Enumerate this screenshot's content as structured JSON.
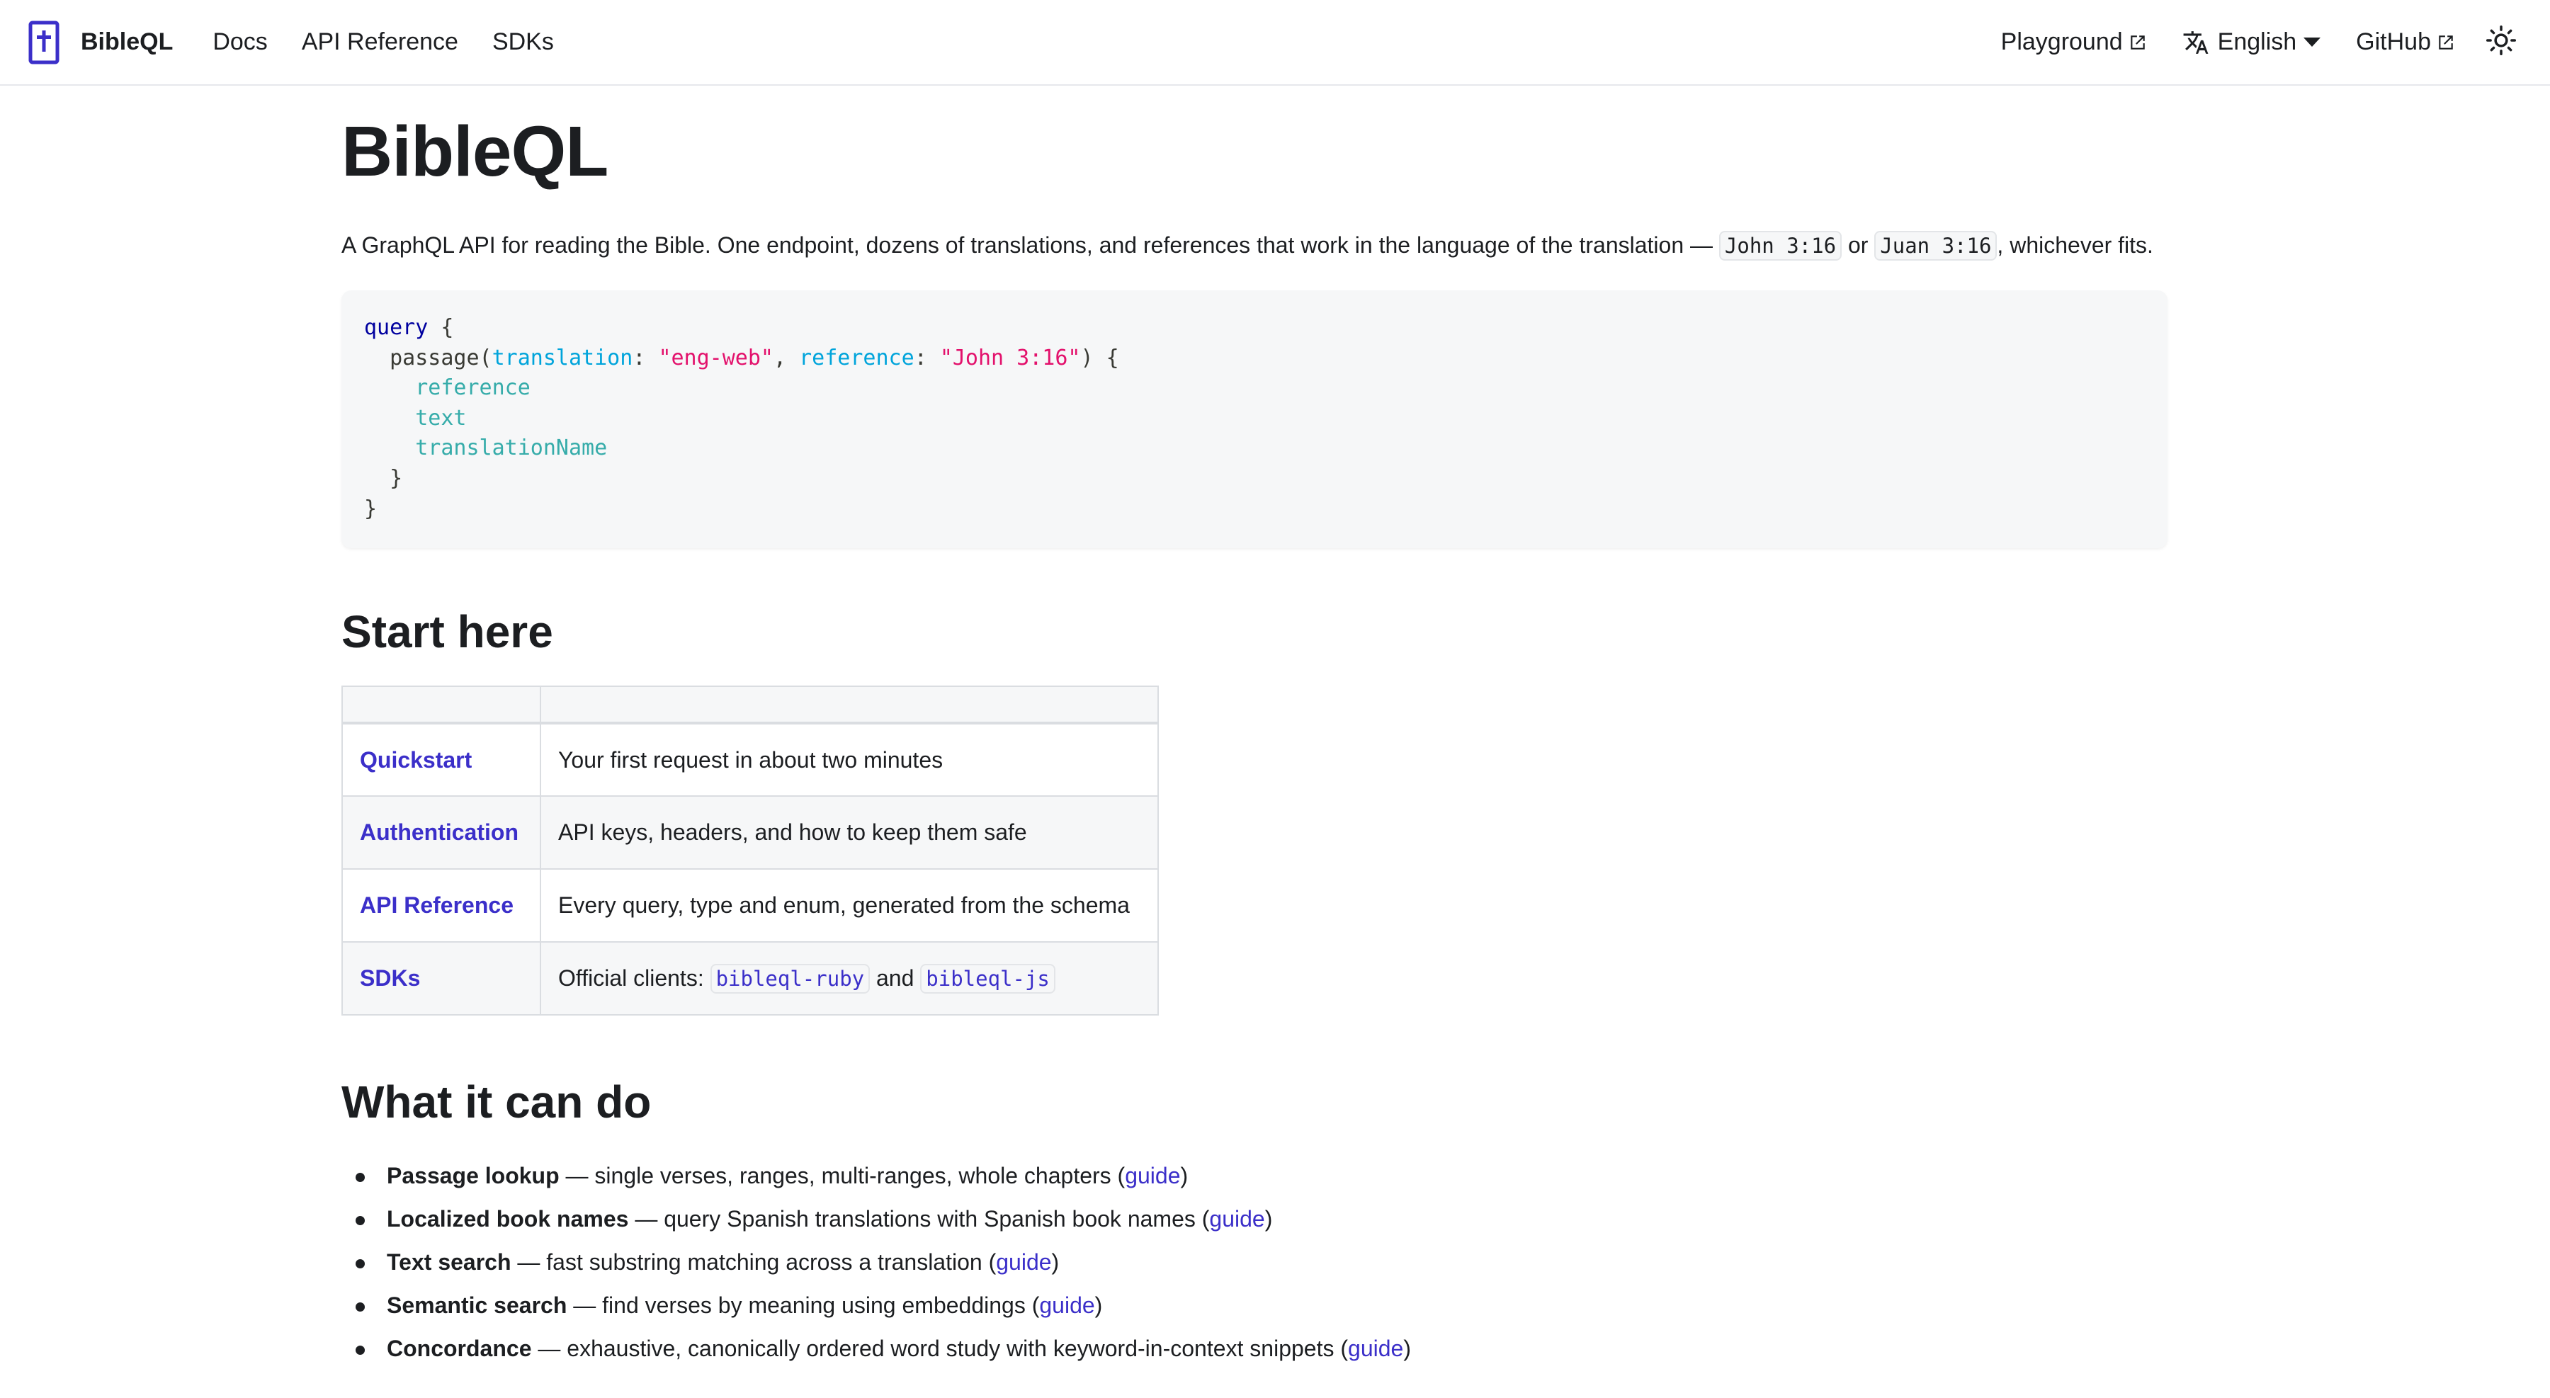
{
  "nav": {
    "brand": "BibleQL",
    "links": [
      "Docs",
      "API Reference",
      "SDKs"
    ],
    "playground": "Playground",
    "language": "English",
    "github": "GitHub"
  },
  "page": {
    "title": "BibleQL",
    "intro_text": "A GraphQL API for reading the Bible. One endpoint, dozens of translations, and references that work in the language of the translation —",
    "intro_code1": "John 3:16",
    "intro_or": "or",
    "intro_code2": "Juan 3:16",
    "intro_end": ", whichever fits."
  },
  "code_example": {
    "l1_kw": "query",
    "l1_rest": " {",
    "l2_indent": "  passage(",
    "l2_arg1": "translation",
    "l2_sep1": ": ",
    "l2_val1": "\"eng-web\"",
    "l2_comma": ", ",
    "l2_arg2": "reference",
    "l2_sep2": ": ",
    "l2_val2": "\"John 3:16\"",
    "l2_end": ") {",
    "fields": [
      "reference",
      "text",
      "translationName"
    ],
    "l6": "  }",
    "l7": "}"
  },
  "start_here": {
    "heading": "Start here",
    "rows": [
      {
        "link": "Quickstart",
        "desc": "Your first request in about two minutes"
      },
      {
        "link": "Authentication",
        "desc": "API keys, headers, and how to keep them safe"
      },
      {
        "link": "API Reference",
        "desc": "Every query, type and enum, generated from the schema"
      },
      {
        "link": "SDKs",
        "desc_prefix": "Official clients:",
        "pkg1": "bibleql-ruby",
        "and": "and",
        "pkg2": "bibleql-js"
      }
    ]
  },
  "features": {
    "heading": "What it can do",
    "items": [
      {
        "title": "Passage lookup",
        "desc": " — single verses, ranges, multi-ranges, whole chapters (",
        "link": "guide",
        "close": ")"
      },
      {
        "title": "Localized book names",
        "desc": " — query Spanish translations with Spanish book names (",
        "link": "guide",
        "close": ")"
      },
      {
        "title": "Text search",
        "desc": " — fast substring matching across a translation (",
        "link": "guide",
        "close": ")"
      },
      {
        "title": "Semantic search",
        "desc": " — find verses by meaning using embeddings (",
        "link": "guide",
        "close": ")"
      },
      {
        "title": "Concordance",
        "desc": " — exhaustive, canonically ordered word study with keyword-in-context snippets (",
        "link": "guide",
        "close": ")"
      }
    ]
  },
  "colors": {
    "accent": "#3b2fc9",
    "code_bg": "#f6f7f8",
    "keyword": "#00009f",
    "attr": "#00a4db",
    "string": "#e3116c",
    "field": "#36acaa"
  },
  "icons": [
    "bible-cross-icon",
    "external-link-icon",
    "translate-icon",
    "caret-down-icon",
    "sun-icon"
  ]
}
